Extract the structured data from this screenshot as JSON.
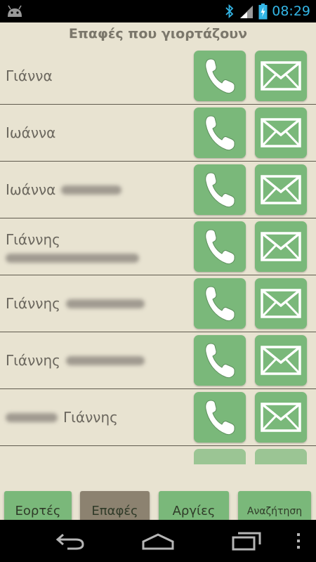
{
  "status_bar": {
    "time": "08:29",
    "icons": [
      "android-icon",
      "bluetooth-icon",
      "signal-icon",
      "battery-charging-icon"
    ],
    "time_color": "#33b5e5"
  },
  "header": {
    "title": "Επαφές που γιορτάζουν"
  },
  "contacts": [
    {
      "name": "Γιάννα"
    },
    {
      "name": "Ιωάννα"
    },
    {
      "name": "Ιωάννα"
    },
    {
      "name": "Γιάννης"
    },
    {
      "name": "Γιάννης"
    },
    {
      "name": "Γιάννης"
    },
    {
      "name": "Γιάννης"
    }
  ],
  "row_actions": {
    "call_icon": "phone-handset-icon",
    "message_icon": "envelope-icon"
  },
  "tabs": [
    {
      "label": "Εορτές",
      "active": false
    },
    {
      "label": "Επαφές",
      "active": true
    },
    {
      "label": "Αργίες",
      "active": false
    },
    {
      "label": "Αναζήτηση",
      "active": false
    }
  ],
  "nav_bar": {
    "icons": [
      "back-icon",
      "home-icon",
      "recent-apps-icon",
      "overflow-menu-icon"
    ]
  },
  "colors": {
    "background": "#e8e3d1",
    "button_green": "#7ab87a",
    "tab_active": "#8c8270",
    "title_text": "#7b776b"
  }
}
